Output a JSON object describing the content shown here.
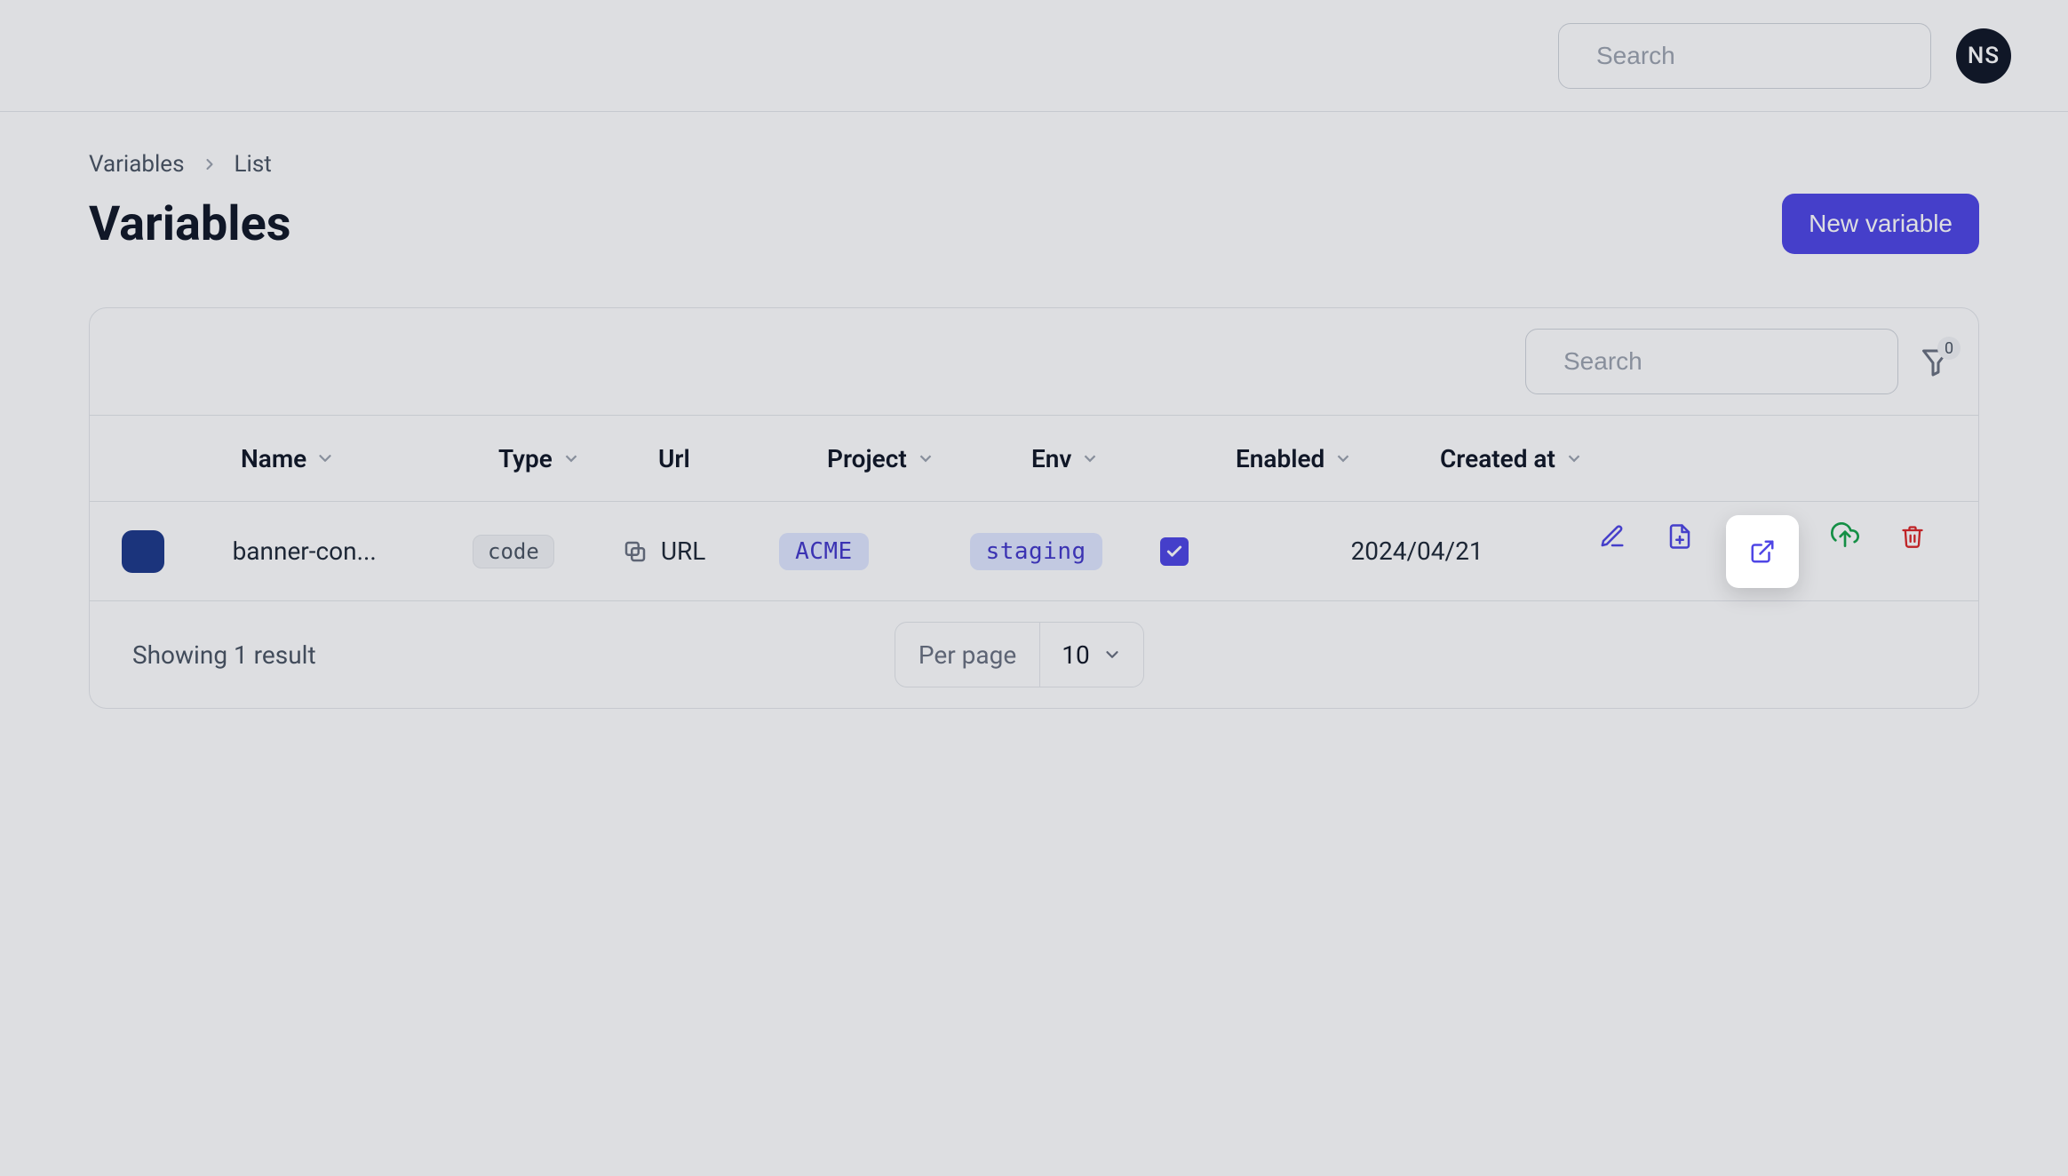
{
  "header": {
    "search_placeholder": "Search",
    "avatar_initials": "NS"
  },
  "breadcrumb": {
    "items": [
      "Variables",
      "List"
    ]
  },
  "page_title": "Variables",
  "new_button_label": "New variable",
  "panel": {
    "search_placeholder": "Search",
    "filter_count": "0"
  },
  "columns": {
    "name": "Name",
    "type": "Type",
    "url": "Url",
    "project": "Project",
    "env": "Env",
    "enabled": "Enabled",
    "created": "Created at"
  },
  "rows": [
    {
      "swatch_color": "#1e3a8a",
      "name": "banner-con...",
      "type_chip": "code",
      "url_label": "URL",
      "project": "ACME",
      "env": "staging",
      "enabled": true,
      "created_at": "2024/04/21"
    }
  ],
  "footer": {
    "result_text": "Showing 1 result",
    "per_page_label": "Per page",
    "per_page_value": "10"
  }
}
